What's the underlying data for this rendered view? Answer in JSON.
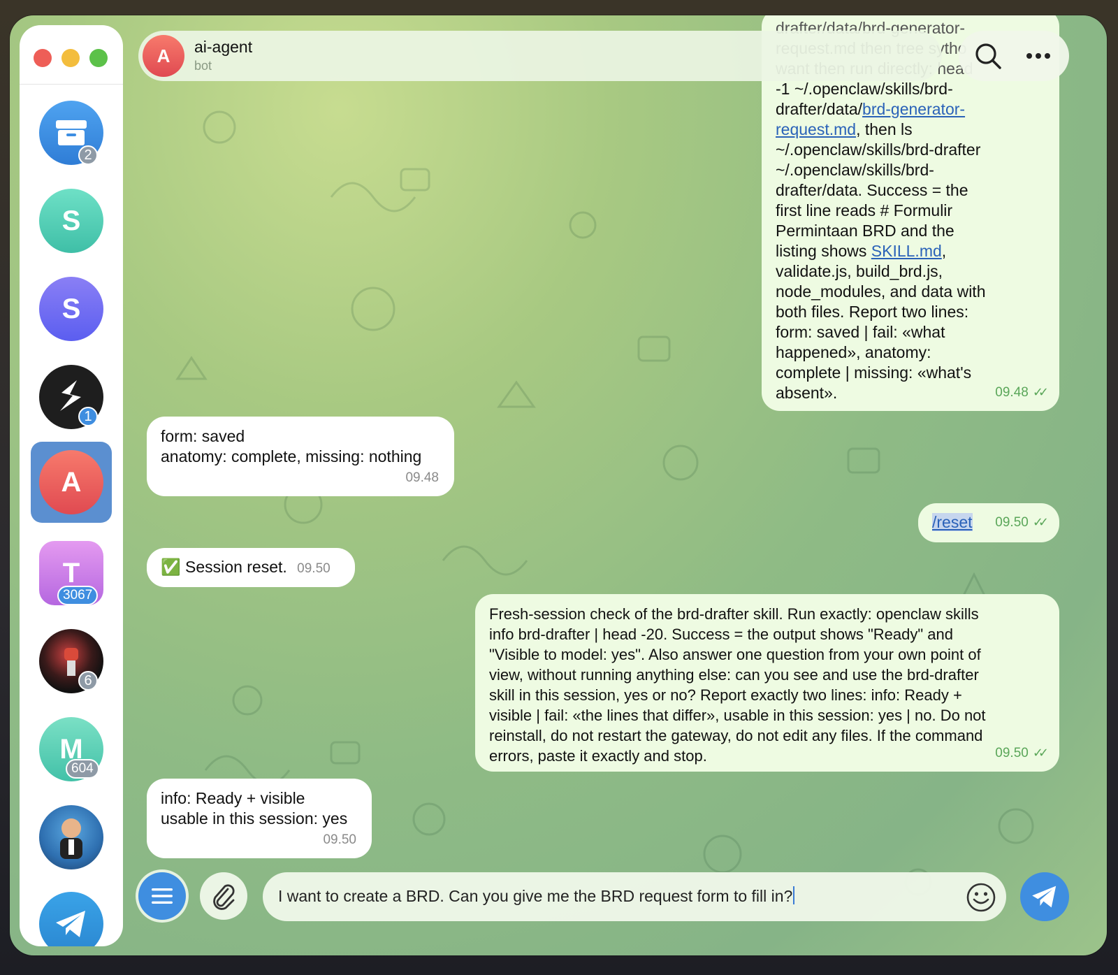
{
  "header": {
    "title": "ai-agent",
    "subtitle": "bot",
    "avatar_letter": "A"
  },
  "sidebar": {
    "items": [
      {
        "name": "archive",
        "badge": "2"
      },
      {
        "name": "chat-s-teal",
        "letter": "S"
      },
      {
        "name": "chat-s-purple",
        "letter": "S"
      },
      {
        "name": "chat-dark-logo",
        "badge": "1"
      },
      {
        "name": "chat-ai-agent",
        "letter": "A",
        "active": true
      },
      {
        "name": "chat-t",
        "letter": "T",
        "badge": "3067"
      },
      {
        "name": "chat-fist-photo",
        "badge": "6"
      },
      {
        "name": "chat-m",
        "letter": "M",
        "badge": "604"
      },
      {
        "name": "chat-photo-man"
      },
      {
        "name": "telegram"
      }
    ]
  },
  "messages": {
    "m1": {
      "partial_top": "drafter/data/brd-generator-",
      "line2": "request.md  then tree sytho",
      "line3": "want  then run directly: head",
      "pre_link": "-1 ~/.openclaw/skills/brd-\ndrafter/data/",
      "link1": "brd-generator-\nrequest.md",
      "mid": ", then ls\n~/.openclaw/skills/brd-drafter\n~/.openclaw/skills/brd-\ndrafter/data. Success = the\nfirst line reads # Formulir\nPermintaan BRD and the\nlisting shows ",
      "link2": "SKILL.md",
      "post": ",\nvalidate.js, build_brd.js,\nnode_modules, and data with\nboth files. Report two lines:\nform: saved | fail: «what\nhappened», anatomy:\ncomplete | missing: «what's\nabsent».",
      "time": "09.48"
    },
    "m2": {
      "text": "form: saved\nanatomy: complete, missing: nothing",
      "time": "09.48"
    },
    "m3": {
      "text": "/reset",
      "time": "09.50"
    },
    "m4": {
      "emoji": "✅",
      "text": "Session reset.",
      "time": "09.50"
    },
    "m5": {
      "text": "Fresh-session check of the brd-drafter skill. Run exactly: openclaw skills\ninfo brd-drafter | head -20. Success = the output shows \"Ready\" and\n\"Visible to model: yes\". Also answer one question from your own point of\nview, without running anything else: can you see and use the brd-drafter\nskill in this session, yes or no? Report exactly two lines: info: Ready +\nvisible | fail: «the lines that differ», usable in this session: yes | no. Do not\nreinstall, do not restart the gateway, do not edit any files. If the command\nerrors, paste it exactly and stop.",
      "time": "09.50"
    },
    "m6": {
      "text": "info: Ready + visible\nusable in this session: yes",
      "time": "09.50"
    }
  },
  "composer": {
    "value": "I want to create a BRD. Can you give me the BRD request form to fill in?"
  },
  "colors": {
    "accent": "#3f8ee0",
    "outgoing": "#eefbe2",
    "incoming": "#ffffff",
    "time_out": "#5aa659"
  }
}
